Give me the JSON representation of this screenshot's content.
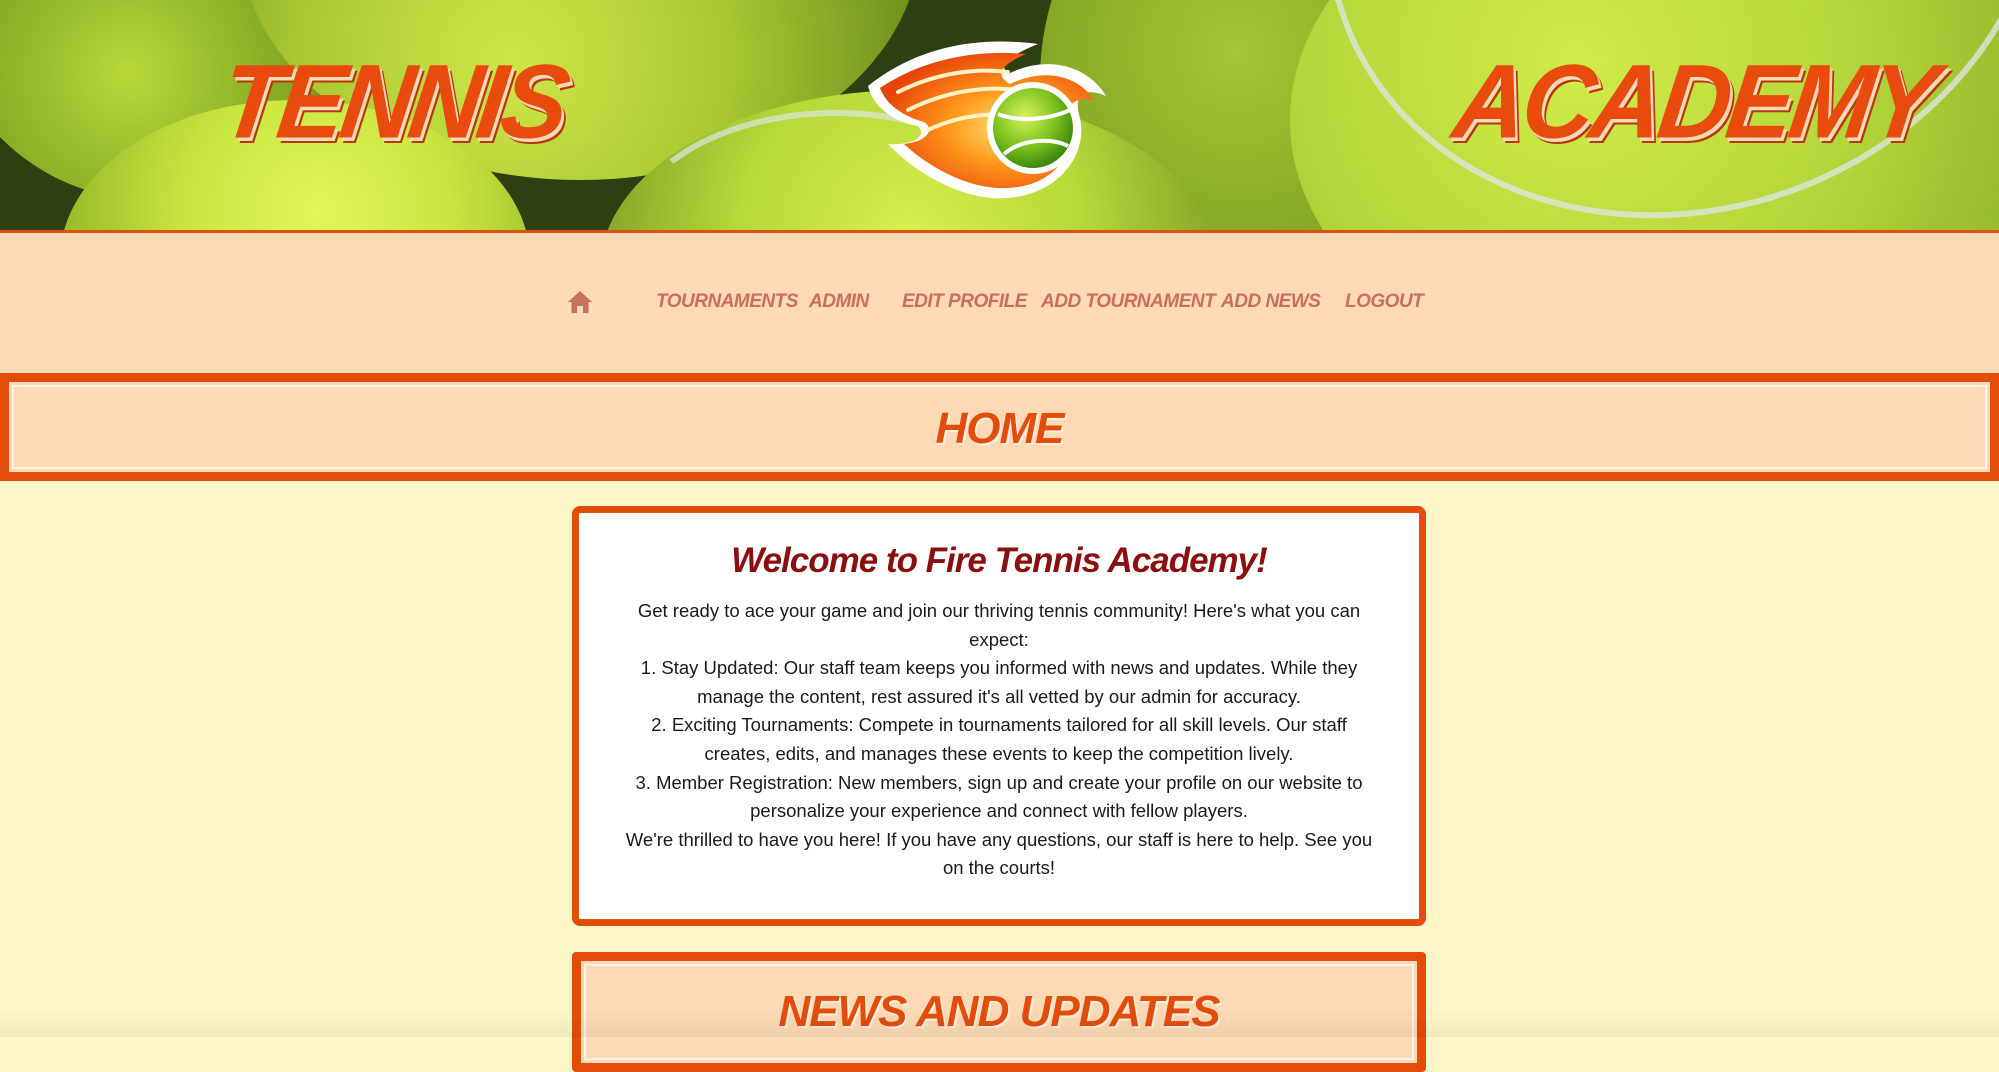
{
  "banner": {
    "left_word": "TENNIS",
    "right_word": "ACADEMY",
    "logo_icon": "flaming-tennis-ball-icon"
  },
  "nav": {
    "home_icon": "home-icon",
    "items": [
      {
        "label": "TOURNAMENTS"
      },
      {
        "label": "ADMIN"
      },
      {
        "label": "EDIT PROFILE"
      },
      {
        "label": "ADD TOURNAMENT"
      },
      {
        "label": "ADD NEWS"
      },
      {
        "label": "LOGOUT"
      }
    ]
  },
  "page": {
    "title": "HOME"
  },
  "welcome": {
    "heading": "Welcome to Fire Tennis Academy!",
    "lines": [
      "Get ready to ace your game and join our thriving tennis community! Here's what you can expect:",
      "1. Stay Updated: Our staff team keeps you informed with news and updates. While they manage the content, rest assured it's all vetted by our admin for accuracy.",
      "2. Exciting Tournaments: Compete in tournaments tailored for all skill levels. Our staff creates, edits, and manages these events to keep the competition lively.",
      "3. Member Registration: New members, sign up and create your profile on our website to personalize your experience and connect with fellow players.",
      "We're thrilled to have you here! If you have any questions, our staff is here to help. See you on the courts!"
    ]
  },
  "news": {
    "title": "NEWS AND UPDATES"
  },
  "colors": {
    "accent": "#e24d0c",
    "nav_bg": "#fdd9b5",
    "page_bg": "#fdf6c8",
    "heading_dark": "#8a0f0f",
    "nav_link": "#c8705a"
  }
}
